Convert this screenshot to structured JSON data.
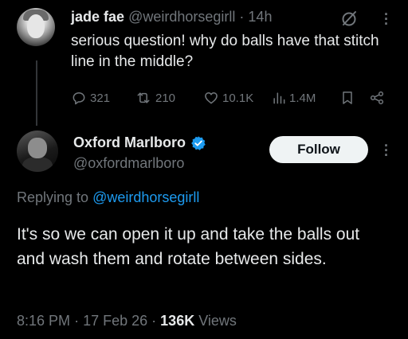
{
  "parent_tweet": {
    "display_name": "jade fae",
    "handle": "@weirdhorsegirll",
    "separator": "·",
    "time_ago": "14h",
    "text": "serious question! why do balls have that stitch line in the middle?",
    "actions": {
      "replies": "321",
      "reposts": "210",
      "likes": "10.1K",
      "views": "1.4M"
    }
  },
  "reply_tweet": {
    "display_name": "Oxford Marlboro",
    "handle": "@oxfordmarlboro",
    "verified": true,
    "follow_label": "Follow",
    "replying_prefix": "Replying to",
    "replying_to": "@weirdhorsegirll",
    "text": "It's so we can open it up and take the balls out and wash them and rotate between sides.",
    "time": "8:16 PM",
    "date": "17 Feb 26",
    "separator": "·",
    "views_count": "136K",
    "views_label": "Views"
  },
  "colors": {
    "background": "#000000",
    "text": "#e7e9ea",
    "muted": "#71767b",
    "link": "#1d9bf0",
    "verified": "#1d9bf0"
  }
}
